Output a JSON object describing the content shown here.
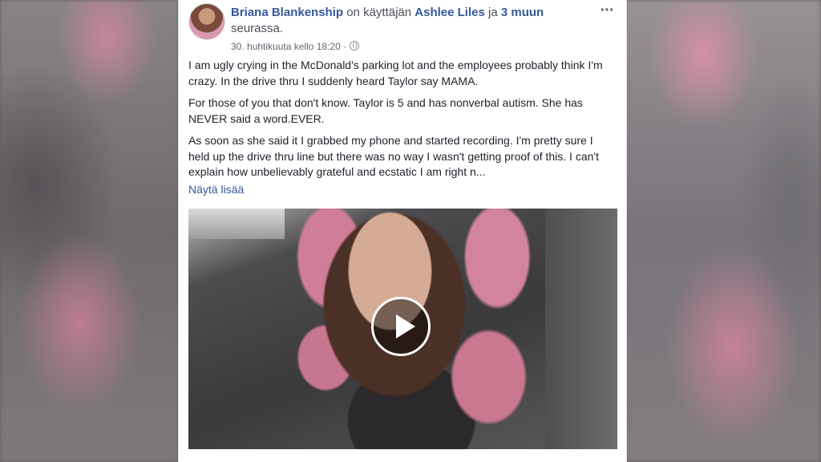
{
  "post": {
    "author": "Briana Blankenship",
    "with_prefix": " on käyttäjän ",
    "tagged_user": "Ashlee Liles",
    "with_suffix": " ja ",
    "others": "3 muun",
    "location_suffix": " seurassa.",
    "timestamp": "30. huhtikuuta kello 18:20 ·",
    "privacy_icon": "globe-icon",
    "more_icon": "more-options-icon",
    "paragraphs": [
      "I am ugly crying in the McDonald's parking lot and the employees probably think I'm crazy. In the drive thru I suddenly heard Taylor say MAMA.",
      "For those of you that don't know. Taylor is 5 and has nonverbal autism. She has NEVER said a word.EVER.",
      "As soon as she said it I grabbed my phone and started recording. I'm pretty sure I held up the drive thru line but there was no way I wasn't getting proof of this. I can't explain how unbelievably grateful and ecstatic I am right n..."
    ],
    "see_more": "Näytä lisää",
    "video": {
      "play_icon": "play-icon"
    }
  }
}
